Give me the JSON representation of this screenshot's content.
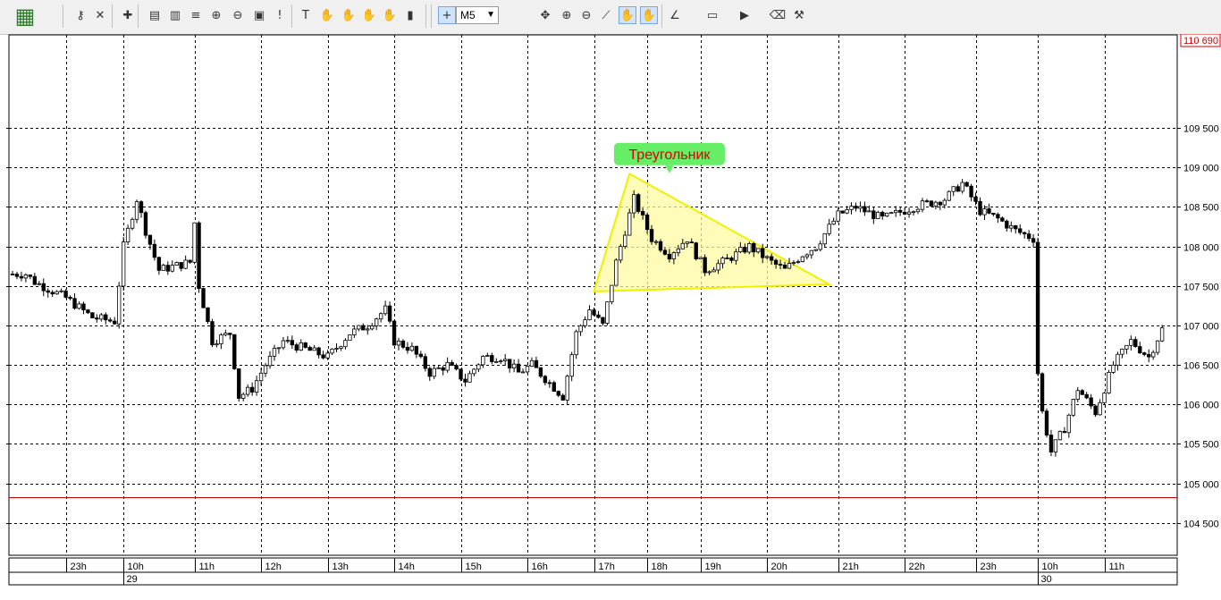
{
  "toolbar": {
    "timeframe": "M5",
    "icons": [
      "app-logo-icon",
      "key-icon",
      "delete-objects-icon",
      "new-chart-icon",
      "bar-chart-icon",
      "candle-chart-icon",
      "line-chart-icon",
      "zoom-in-icon",
      "zoom-out-icon",
      "template-icon",
      "period-separator-icon",
      "text-tool-icon",
      "hand-icon",
      "hand-icon",
      "hand-icon",
      "hand-icon",
      "indicators-icon",
      "crosshair-icon",
      "move-icon",
      "zoom-in-small-icon",
      "zoom-out-small-icon",
      "ruler-icon",
      "hand-scroll-icon",
      "hand-drag-icon",
      "trendline-icon",
      "label-icon",
      "arrow-icon",
      "eraser-icon",
      "tools-icon"
    ]
  },
  "colors": {
    "bull_fill": "#ffffff",
    "bear_fill": "#000000",
    "candle_line": "#000000",
    "grid": "#000000",
    "price_line": "#c00000",
    "current_price_text": "#d00000",
    "triangle_fill": "#fffaa0",
    "triangle_stroke": "#f0f000",
    "annotation_bg": "#66ee66",
    "annotation_text": "#dd0000"
  },
  "annotation": {
    "text": "Треугольник"
  },
  "chart_data": {
    "type": "candlestick",
    "current_price_label": "110 690",
    "price_line_value": 104820,
    "ylim": [
      104100,
      110690
    ],
    "y_ticks": [
      {
        "value": 109500,
        "label": "109 500"
      },
      {
        "value": 109000,
        "label": "109 000"
      },
      {
        "value": 108500,
        "label": "108 500"
      },
      {
        "value": 108000,
        "label": "108 000"
      },
      {
        "value": 107500,
        "label": "107 500"
      },
      {
        "value": 107000,
        "label": "107 000"
      },
      {
        "value": 106500,
        "label": "106 500"
      },
      {
        "value": 106000,
        "label": "106 000"
      },
      {
        "value": 105500,
        "label": "105 500"
      },
      {
        "value": 105000,
        "label": "105 000"
      },
      {
        "value": 104500,
        "label": "104 500"
      }
    ],
    "x_ticks": [
      {
        "bar": 12,
        "label": "23h"
      },
      {
        "bar": 25,
        "label": "10h"
      },
      {
        "bar": 41,
        "label": "11h"
      },
      {
        "bar": 56,
        "label": "12h"
      },
      {
        "bar": 71,
        "label": "13h"
      },
      {
        "bar": 86,
        "label": "14h"
      },
      {
        "bar": 101,
        "label": "15h"
      },
      {
        "bar": 116,
        "label": "16h"
      },
      {
        "bar": 131,
        "label": "17h"
      },
      {
        "bar": 143,
        "label": "18h"
      },
      {
        "bar": 155,
        "label": "19h"
      },
      {
        "bar": 170,
        "label": "20h"
      },
      {
        "bar": 186,
        "label": "21h"
      },
      {
        "bar": 201,
        "label": "22h"
      },
      {
        "bar": 217,
        "label": "23h"
      },
      {
        "bar": 231,
        "label": "10h"
      },
      {
        "bar": 246,
        "label": "11h"
      }
    ],
    "date_labels": [
      {
        "bar": 25,
        "label": "29"
      },
      {
        "bar": 231,
        "label": "30"
      }
    ],
    "triangle": [
      {
        "bar": 131,
        "price": 107430
      },
      {
        "bar": 139,
        "price": 108920
      },
      {
        "bar": 184,
        "price": 107520
      }
    ],
    "annotation_anchor": {
      "bar": 148,
      "price": 109170
    },
    "anchors": [
      {
        "bar": 0,
        "price": 107650
      },
      {
        "bar": 3,
        "price": 107650
      },
      {
        "bar": 5,
        "price": 107550
      },
      {
        "bar": 12,
        "price": 107350
      },
      {
        "bar": 18,
        "price": 107100
      },
      {
        "bar": 23,
        "price": 107050
      },
      {
        "bar": 25,
        "price": 108000
      },
      {
        "bar": 28,
        "price": 108600
      },
      {
        "bar": 30,
        "price": 108200
      },
      {
        "bar": 33,
        "price": 107700
      },
      {
        "bar": 40,
        "price": 107800
      },
      {
        "bar": 41,
        "price": 108300
      },
      {
        "bar": 42,
        "price": 107500
      },
      {
        "bar": 45,
        "price": 106800
      },
      {
        "bar": 49,
        "price": 106900
      },
      {
        "bar": 51,
        "price": 106100
      },
      {
        "bar": 54,
        "price": 106200
      },
      {
        "bar": 57,
        "price": 106500
      },
      {
        "bar": 61,
        "price": 106800
      },
      {
        "bar": 66,
        "price": 106700
      },
      {
        "bar": 71,
        "price": 106600
      },
      {
        "bar": 76,
        "price": 106900
      },
      {
        "bar": 80,
        "price": 107000
      },
      {
        "bar": 84,
        "price": 107200
      },
      {
        "bar": 86,
        "price": 106800
      },
      {
        "bar": 90,
        "price": 106700
      },
      {
        "bar": 94,
        "price": 106400
      },
      {
        "bar": 98,
        "price": 106500
      },
      {
        "bar": 102,
        "price": 106300
      },
      {
        "bar": 106,
        "price": 106600
      },
      {
        "bar": 110,
        "price": 106600
      },
      {
        "bar": 114,
        "price": 106400
      },
      {
        "bar": 117,
        "price": 106500
      },
      {
        "bar": 124,
        "price": 106100
      },
      {
        "bar": 127,
        "price": 106900
      },
      {
        "bar": 130,
        "price": 107200
      },
      {
        "bar": 133,
        "price": 107000
      },
      {
        "bar": 136,
        "price": 107800
      },
      {
        "bar": 140,
        "price": 108600
      },
      {
        "bar": 144,
        "price": 108100
      },
      {
        "bar": 148,
        "price": 107900
      },
      {
        "bar": 152,
        "price": 108100
      },
      {
        "bar": 156,
        "price": 107700
      },
      {
        "bar": 160,
        "price": 107800
      },
      {
        "bar": 166,
        "price": 108000
      },
      {
        "bar": 171,
        "price": 107800
      },
      {
        "bar": 174,
        "price": 107700
      },
      {
        "bar": 178,
        "price": 107900
      },
      {
        "bar": 181,
        "price": 108000
      },
      {
        "bar": 186,
        "price": 108400
      },
      {
        "bar": 190,
        "price": 108500
      },
      {
        "bar": 196,
        "price": 108350
      },
      {
        "bar": 203,
        "price": 108500
      },
      {
        "bar": 210,
        "price": 108600
      },
      {
        "bar": 214,
        "price": 108800
      },
      {
        "bar": 218,
        "price": 108450
      },
      {
        "bar": 222,
        "price": 108350
      },
      {
        "bar": 226,
        "price": 108200
      },
      {
        "bar": 230,
        "price": 108100
      },
      {
        "bar": 231,
        "price": 106400
      },
      {
        "bar": 232,
        "price": 105900
      },
      {
        "bar": 234,
        "price": 105400
      },
      {
        "bar": 237,
        "price": 105700
      },
      {
        "bar": 240,
        "price": 106200
      },
      {
        "bar": 244,
        "price": 105900
      },
      {
        "bar": 248,
        "price": 106500
      },
      {
        "bar": 252,
        "price": 106800
      },
      {
        "bar": 256,
        "price": 106600
      },
      {
        "bar": 259,
        "price": 106950
      }
    ]
  }
}
